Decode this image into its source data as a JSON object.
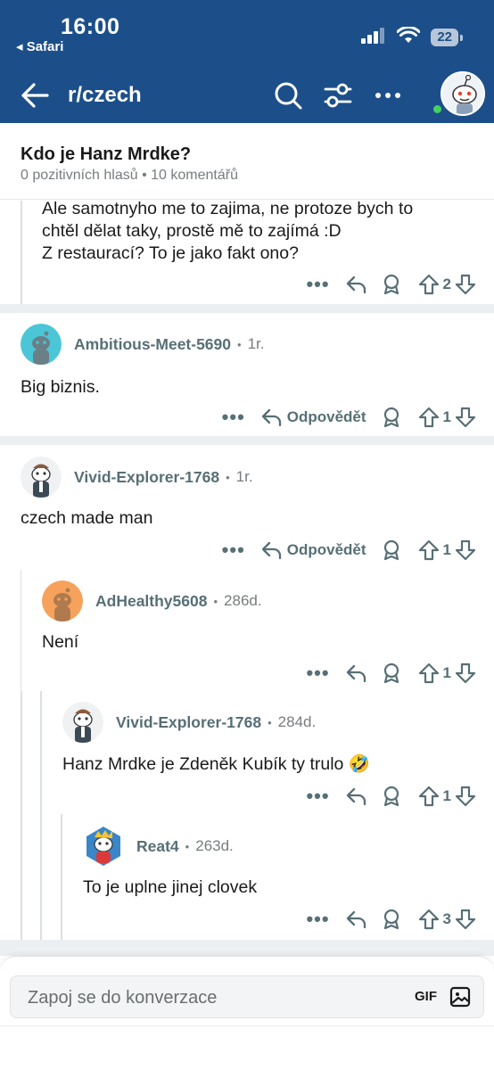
{
  "status": {
    "time": "16:00",
    "back_app": "◂ Safari",
    "battery": "22"
  },
  "nav": {
    "subreddit": "r/czech"
  },
  "post": {
    "title": "Kdo je Hanz Mrdke?",
    "meta": "0 pozitivních hlasů • 10 komentářů"
  },
  "comments": [
    {
      "lines": [
        "Ale samotnyho me to zajima, ne protoze bych to",
        "chtěl dělat taky, prostě mě to zajímá :D",
        "Z restaurací? To je jako fakt ono?"
      ],
      "votes": "2"
    },
    {
      "author": "Ambitious-Meet-5690",
      "age": "1r.",
      "text": "Big biznis.",
      "reply_label": "Odpovědět",
      "votes": "1"
    },
    {
      "author": "Vivid-Explorer-1768",
      "age": "1r.",
      "text": "czech made man",
      "reply_label": "Odpovědět",
      "votes": "1"
    },
    {
      "author": "AdHealthy5608",
      "age": "286d.",
      "text": "Není",
      "votes": "1"
    },
    {
      "author": "Vivid-Explorer-1768",
      "age": "284d.",
      "text": "Hanz Mrdke je Zdeněk Kubík ty trulo 🤣",
      "votes": "1"
    },
    {
      "author": "Reat4",
      "age": "263d.",
      "text": "To je uplne jinej clovek",
      "votes": "3"
    }
  ],
  "composer": {
    "placeholder": "Zapoj se do konverzace",
    "gif_label": "GIF"
  },
  "colors": {
    "header_bg": "#1c4f8a",
    "meta_text": "#576f76",
    "online": "#46d160"
  }
}
